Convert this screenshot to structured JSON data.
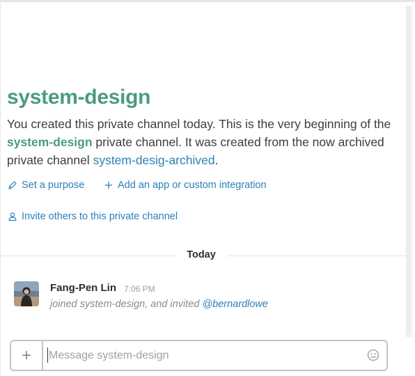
{
  "channel": {
    "title": "system-design",
    "intro_part1": "You created this private channel today. This is the very beginning of the ",
    "intro_channel_link": "system-design",
    "intro_part2": " private channel. It was created from the now archived private channel ",
    "intro_archived_link": "system-desig-archived",
    "intro_end": "."
  },
  "actions": {
    "set_purpose": "Set a purpose",
    "add_app": "Add an app or custom integration",
    "invite": "Invite others to this private channel"
  },
  "divider": {
    "label": "Today"
  },
  "message": {
    "author": "Fang-Pen Lin",
    "time": "7:06 PM",
    "text": "joined system-design, and invited ",
    "mention": "@bernardlowe"
  },
  "composer": {
    "plus_label": "+",
    "placeholder": "Message system-design"
  },
  "icons": {
    "pencil": "pencil-icon",
    "plus": "plus-icon",
    "person": "person-icon",
    "emoji": "emoji-icon"
  },
  "colors": {
    "channel_green": "#4a9b7f",
    "link_blue": "#2a80b9",
    "muted_text": "#8a8a93"
  }
}
